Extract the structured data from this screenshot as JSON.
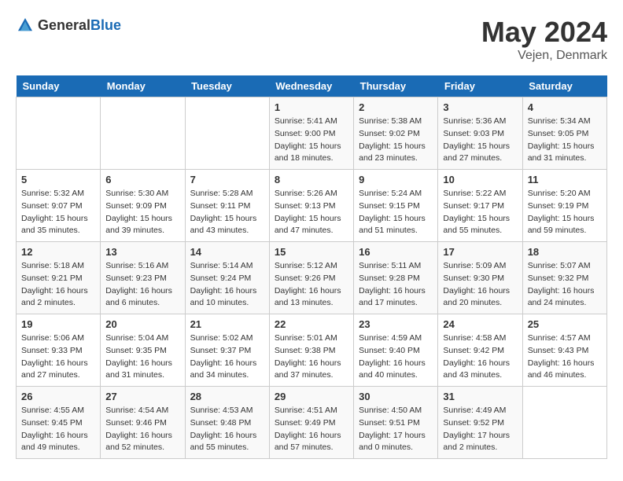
{
  "header": {
    "logo_general": "General",
    "logo_blue": "Blue",
    "title": "May 2024",
    "subtitle": "Vejen, Denmark"
  },
  "weekdays": [
    "Sunday",
    "Monday",
    "Tuesday",
    "Wednesday",
    "Thursday",
    "Friday",
    "Saturday"
  ],
  "weeks": [
    [
      {
        "day": "",
        "info": ""
      },
      {
        "day": "",
        "info": ""
      },
      {
        "day": "",
        "info": ""
      },
      {
        "day": "1",
        "info": "Sunrise: 5:41 AM\nSunset: 9:00 PM\nDaylight: 15 hours\nand 18 minutes."
      },
      {
        "day": "2",
        "info": "Sunrise: 5:38 AM\nSunset: 9:02 PM\nDaylight: 15 hours\nand 23 minutes."
      },
      {
        "day": "3",
        "info": "Sunrise: 5:36 AM\nSunset: 9:03 PM\nDaylight: 15 hours\nand 27 minutes."
      },
      {
        "day": "4",
        "info": "Sunrise: 5:34 AM\nSunset: 9:05 PM\nDaylight: 15 hours\nand 31 minutes."
      }
    ],
    [
      {
        "day": "5",
        "info": "Sunrise: 5:32 AM\nSunset: 9:07 PM\nDaylight: 15 hours\nand 35 minutes."
      },
      {
        "day": "6",
        "info": "Sunrise: 5:30 AM\nSunset: 9:09 PM\nDaylight: 15 hours\nand 39 minutes."
      },
      {
        "day": "7",
        "info": "Sunrise: 5:28 AM\nSunset: 9:11 PM\nDaylight: 15 hours\nand 43 minutes."
      },
      {
        "day": "8",
        "info": "Sunrise: 5:26 AM\nSunset: 9:13 PM\nDaylight: 15 hours\nand 47 minutes."
      },
      {
        "day": "9",
        "info": "Sunrise: 5:24 AM\nSunset: 9:15 PM\nDaylight: 15 hours\nand 51 minutes."
      },
      {
        "day": "10",
        "info": "Sunrise: 5:22 AM\nSunset: 9:17 PM\nDaylight: 15 hours\nand 55 minutes."
      },
      {
        "day": "11",
        "info": "Sunrise: 5:20 AM\nSunset: 9:19 PM\nDaylight: 15 hours\nand 59 minutes."
      }
    ],
    [
      {
        "day": "12",
        "info": "Sunrise: 5:18 AM\nSunset: 9:21 PM\nDaylight: 16 hours\nand 2 minutes."
      },
      {
        "day": "13",
        "info": "Sunrise: 5:16 AM\nSunset: 9:23 PM\nDaylight: 16 hours\nand 6 minutes."
      },
      {
        "day": "14",
        "info": "Sunrise: 5:14 AM\nSunset: 9:24 PM\nDaylight: 16 hours\nand 10 minutes."
      },
      {
        "day": "15",
        "info": "Sunrise: 5:12 AM\nSunset: 9:26 PM\nDaylight: 16 hours\nand 13 minutes."
      },
      {
        "day": "16",
        "info": "Sunrise: 5:11 AM\nSunset: 9:28 PM\nDaylight: 16 hours\nand 17 minutes."
      },
      {
        "day": "17",
        "info": "Sunrise: 5:09 AM\nSunset: 9:30 PM\nDaylight: 16 hours\nand 20 minutes."
      },
      {
        "day": "18",
        "info": "Sunrise: 5:07 AM\nSunset: 9:32 PM\nDaylight: 16 hours\nand 24 minutes."
      }
    ],
    [
      {
        "day": "19",
        "info": "Sunrise: 5:06 AM\nSunset: 9:33 PM\nDaylight: 16 hours\nand 27 minutes."
      },
      {
        "day": "20",
        "info": "Sunrise: 5:04 AM\nSunset: 9:35 PM\nDaylight: 16 hours\nand 31 minutes."
      },
      {
        "day": "21",
        "info": "Sunrise: 5:02 AM\nSunset: 9:37 PM\nDaylight: 16 hours\nand 34 minutes."
      },
      {
        "day": "22",
        "info": "Sunrise: 5:01 AM\nSunset: 9:38 PM\nDaylight: 16 hours\nand 37 minutes."
      },
      {
        "day": "23",
        "info": "Sunrise: 4:59 AM\nSunset: 9:40 PM\nDaylight: 16 hours\nand 40 minutes."
      },
      {
        "day": "24",
        "info": "Sunrise: 4:58 AM\nSunset: 9:42 PM\nDaylight: 16 hours\nand 43 minutes."
      },
      {
        "day": "25",
        "info": "Sunrise: 4:57 AM\nSunset: 9:43 PM\nDaylight: 16 hours\nand 46 minutes."
      }
    ],
    [
      {
        "day": "26",
        "info": "Sunrise: 4:55 AM\nSunset: 9:45 PM\nDaylight: 16 hours\nand 49 minutes."
      },
      {
        "day": "27",
        "info": "Sunrise: 4:54 AM\nSunset: 9:46 PM\nDaylight: 16 hours\nand 52 minutes."
      },
      {
        "day": "28",
        "info": "Sunrise: 4:53 AM\nSunset: 9:48 PM\nDaylight: 16 hours\nand 55 minutes."
      },
      {
        "day": "29",
        "info": "Sunrise: 4:51 AM\nSunset: 9:49 PM\nDaylight: 16 hours\nand 57 minutes."
      },
      {
        "day": "30",
        "info": "Sunrise: 4:50 AM\nSunset: 9:51 PM\nDaylight: 17 hours\nand 0 minutes."
      },
      {
        "day": "31",
        "info": "Sunrise: 4:49 AM\nSunset: 9:52 PM\nDaylight: 17 hours\nand 2 minutes."
      },
      {
        "day": "",
        "info": ""
      }
    ]
  ]
}
